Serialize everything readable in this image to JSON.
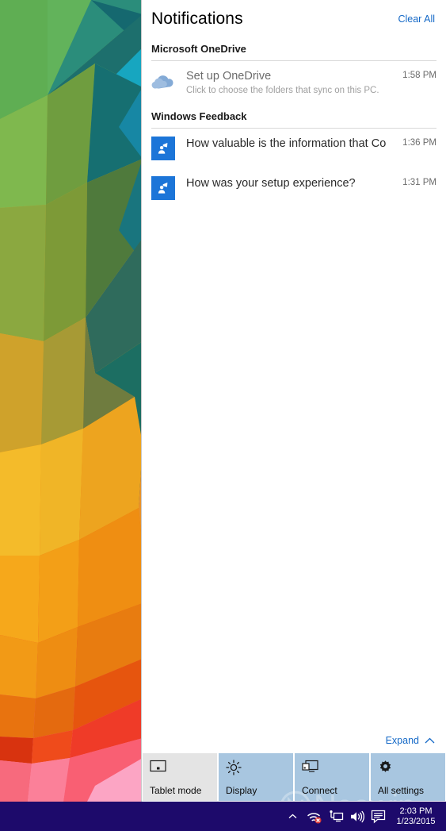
{
  "action_center": {
    "title": "Notifications",
    "clear_all_label": "Clear All",
    "groups": [
      {
        "name": "Microsoft OneDrive",
        "items": [
          {
            "icon": "onedrive-cloud-icon",
            "title": "Set up OneDrive",
            "subtitle": "Click to choose the folders that sync on this PC.",
            "time": "1:58 PM"
          }
        ]
      },
      {
        "name": "Windows Feedback",
        "items": [
          {
            "icon": "windows-feedback-icon",
            "title": "How valuable is the information that Co",
            "subtitle": "",
            "time": "1:36 PM"
          },
          {
            "icon": "windows-feedback-icon",
            "title": "How was your setup experience?",
            "subtitle": "",
            "time": "1:31 PM"
          }
        ]
      }
    ],
    "expand_label": "Expand",
    "expand_icon": "chevron-up-icon",
    "quick_actions": [
      {
        "label": "Tablet mode",
        "icon": "tablet-mode-icon",
        "active": false
      },
      {
        "label": "Display",
        "icon": "brightness-icon",
        "active": true
      },
      {
        "label": "Connect",
        "icon": "connect-display-icon",
        "active": true
      },
      {
        "label": "All settings",
        "icon": "gear-icon",
        "active": true
      }
    ]
  },
  "taskbar": {
    "tray_icons": [
      "show-hidden-icons-chevron-up",
      "wifi-error-icon",
      "network-ethernet-icon",
      "volume-icon",
      "action-center-icon"
    ],
    "clock_time": "2:03 PM",
    "clock_date": "1/23/2015"
  },
  "watermark": {
    "text": "Neowin"
  },
  "colors": {
    "accent_link": "#1569c7",
    "tile_active": "#a8c6e0",
    "tile_inactive": "#e4e4e4",
    "taskbar": "#1d0a6b",
    "feedback_tile": "#1c75d8",
    "panel_background": "#ffffff"
  }
}
